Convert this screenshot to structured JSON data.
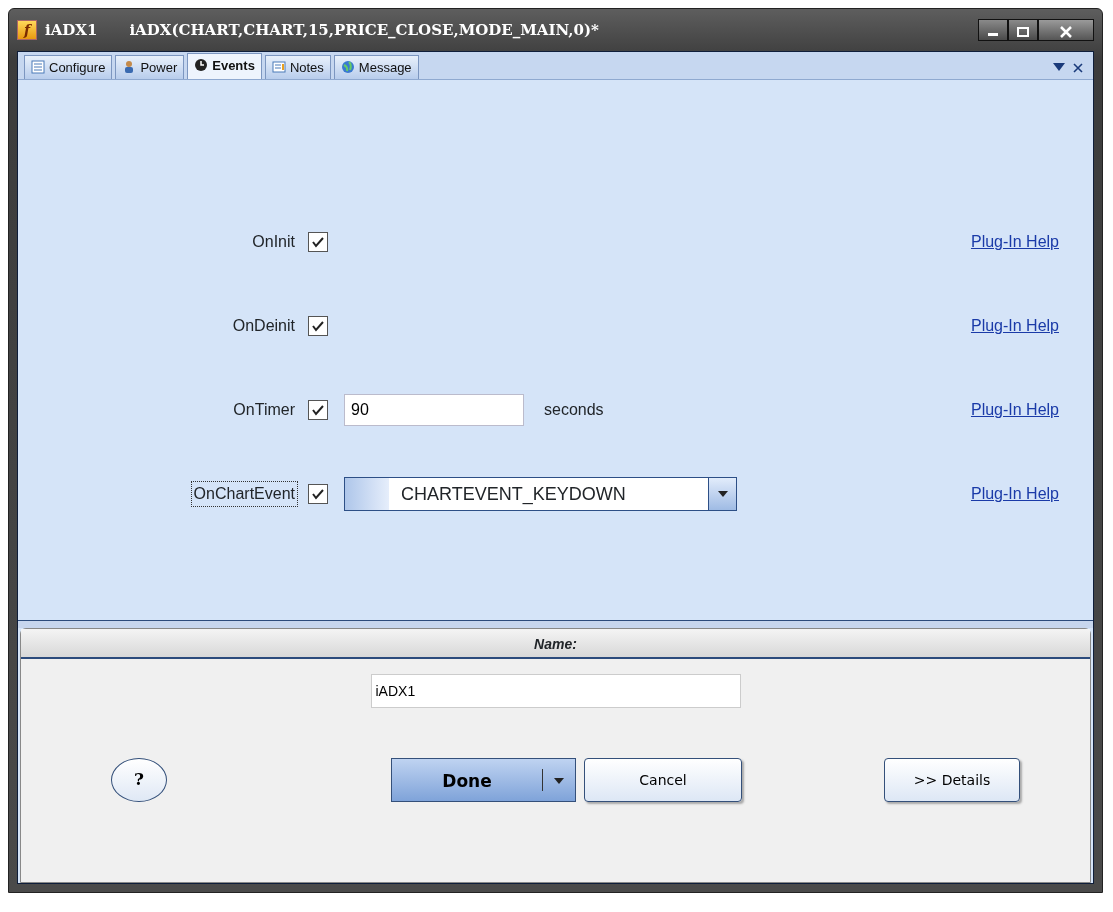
{
  "window": {
    "app_icon": "f",
    "title": "iADX1",
    "subtitle": "iADX(CHART,CHART,15,PRICE_CLOSE,MODE_MAIN,0)*"
  },
  "tabs": [
    {
      "label": "Configure",
      "selected": false
    },
    {
      "label": "Power",
      "selected": false
    },
    {
      "label": "Events",
      "selected": true
    },
    {
      "label": "Notes",
      "selected": false
    },
    {
      "label": "Message",
      "selected": false
    }
  ],
  "events": [
    {
      "kind": "plain",
      "label": "OnInit",
      "checked": true,
      "help": "Plug-In Help"
    },
    {
      "kind": "plain",
      "label": "OnDeinit",
      "checked": true,
      "help": "Plug-In Help"
    },
    {
      "kind": "timer",
      "label": "OnTimer",
      "checked": true,
      "value": "90",
      "unit": "seconds",
      "help": "Plug-In Help"
    },
    {
      "kind": "select",
      "label": "OnChartEvent",
      "checked": true,
      "value": "CHARTEVENT_KEYDOWN",
      "help": "Plug-In Help",
      "focused": true
    }
  ],
  "name_section": {
    "heading": "Name:",
    "value": "iADX1"
  },
  "buttons": {
    "help": "?",
    "done": "Done",
    "cancel": "Cancel",
    "details": ">> Details"
  }
}
